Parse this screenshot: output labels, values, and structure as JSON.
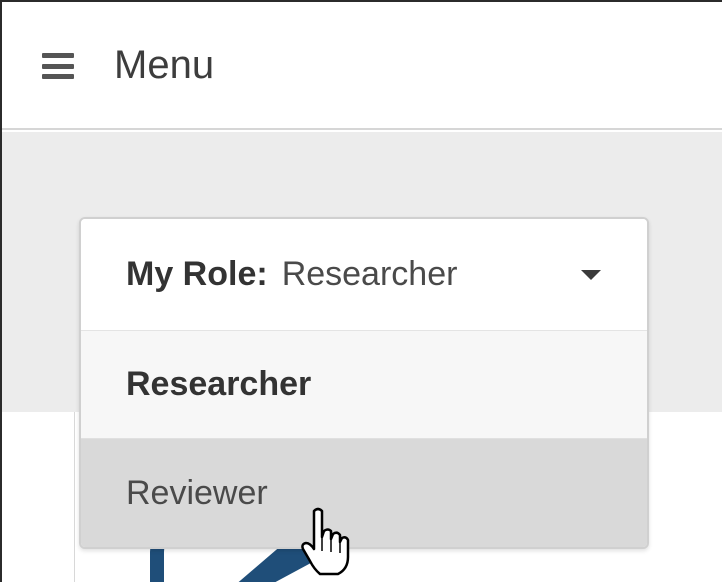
{
  "header": {
    "menu_label": "Menu",
    "menu_icon": "hamburger-icon"
  },
  "role_selector": {
    "prefix": "My Role:",
    "current_value": "Researcher",
    "caret_icon": "caret-down-icon",
    "options": [
      {
        "label": "Researcher",
        "state": "selected"
      },
      {
        "label": "Reviewer",
        "state": "hovered"
      }
    ]
  },
  "icons": {
    "pencil": "pencil-icon",
    "cursor": "hand-pointer-cursor-icon"
  },
  "colors": {
    "accent_icon": "#1f4e79",
    "hover_bg": "#d9d9d9",
    "band_bg": "#ececec"
  }
}
